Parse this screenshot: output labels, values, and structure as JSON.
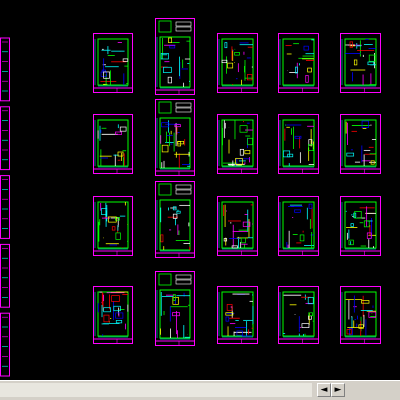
{
  "viewport": {
    "background": "#000000",
    "name": "cad-model-space"
  },
  "colors": {
    "frame": "#ff00ff",
    "walls": [
      "#00ff00",
      "#ffff00",
      "#ff0000",
      "#00ffff",
      "#ffffff",
      "#ff00ff",
      "#0000ff"
    ]
  },
  "drawing_grid": {
    "rows": 4,
    "columns": 5
  },
  "left_strip": {
    "segments": 5
  },
  "scrollbar": {
    "left_arrow": "◄",
    "right_arrow": "►"
  }
}
